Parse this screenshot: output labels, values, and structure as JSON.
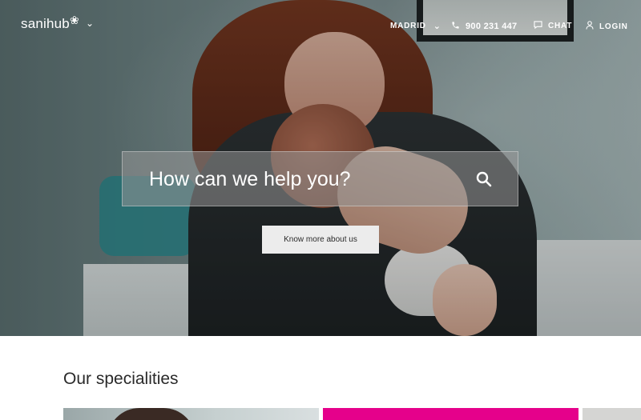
{
  "header": {
    "logo_text": "sanihub",
    "logo_mark": "❀",
    "logo_chevron": "⌄",
    "city": "MADRID",
    "city_chevron": "⌄",
    "phone": "900 231 447",
    "chat_label": "CHAT",
    "login_label": "LOGIN",
    "icons": {
      "phone": "phone-icon",
      "chat": "chat-icon",
      "login": "user-icon"
    }
  },
  "hero": {
    "search_placeholder": "How can we help you?",
    "cta_label": "Know more about us"
  },
  "specialities": {
    "title": "Our specialities",
    "cards": [
      {
        "color": "#9aa7a8"
      },
      {
        "color": "#e5018b"
      },
      {
        "color": "#d5d5d3"
      }
    ]
  }
}
